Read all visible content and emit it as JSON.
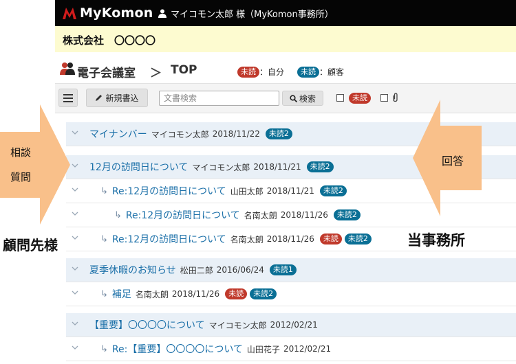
{
  "header": {
    "logo": "MyKomon",
    "user": "マイコモン太郎 様（MyKomon事務所）"
  },
  "company": "株式会社　〇〇〇〇",
  "breadcrumb": {
    "title": "電子会議室",
    "separator": "＞",
    "current": "TOP"
  },
  "legend": {
    "unread_badge": "未読",
    "self_label": "：自分",
    "client_label": "：顧客"
  },
  "toolbar": {
    "new_post": "新規書込",
    "search_placeholder": "文書検索",
    "search_button": "検索",
    "unread_filter": "未読"
  },
  "threads": [
    {
      "level": 0,
      "title": "マイナンバー",
      "author": "マイコモン太郎",
      "date": "2018/11/22",
      "badges": [
        {
          "text": "未読2",
          "color": "blue"
        }
      ]
    },
    {
      "level": 0,
      "title": "12月の訪問日について",
      "author": "マイコモン太郎",
      "date": "2018/11/21",
      "badges": [
        {
          "text": "未読2",
          "color": "blue"
        }
      ]
    },
    {
      "level": 1,
      "title": "Re:12月の訪問日について",
      "author": "山田太郎",
      "date": "2018/11/21",
      "badges": [
        {
          "text": "未読2",
          "color": "blue"
        }
      ]
    },
    {
      "level": 2,
      "title": "Re:12月の訪問日について",
      "author": "名南太朗",
      "date": "2018/11/26",
      "badges": [
        {
          "text": "未読2",
          "color": "blue"
        }
      ]
    },
    {
      "level": 1,
      "title": "Re:12月の訪問日について",
      "author": "名南太朗",
      "date": "2018/11/26",
      "badges": [
        {
          "text": "未読",
          "color": "red"
        },
        {
          "text": "未読2",
          "color": "blue"
        }
      ]
    },
    {
      "level": 0,
      "title": "夏季休暇のお知らせ",
      "author": "松田二郎",
      "date": "2016/06/24",
      "badges": [
        {
          "text": "未読1",
          "color": "blue"
        }
      ]
    },
    {
      "level": 1,
      "title": "補足",
      "author": "名南太朗",
      "date": "2018/11/26",
      "badges": [
        {
          "text": "未読",
          "color": "red"
        },
        {
          "text": "未読2",
          "color": "blue"
        }
      ]
    },
    {
      "level": 0,
      "title": "【重要】〇〇〇〇について",
      "author": "マイコモン太郎",
      "date": "2012/02/21",
      "badges": []
    },
    {
      "level": 1,
      "title": "Re:【重要】〇〇〇〇について",
      "author": "山田花子",
      "date": "2012/02/21",
      "badges": []
    }
  ],
  "annotations": {
    "left_arrow_line1": "相談",
    "left_arrow_line2": "質問",
    "right_arrow_text": "回答",
    "client_label": "顧問先様",
    "office_label": "当事務所"
  },
  "colors": {
    "unread_self": "#c0392b",
    "unread_client": "#0a6f95",
    "arrow": "#f9c08a",
    "company_bar": "#fdfbd0",
    "thread_link": "#1a6fa8"
  }
}
